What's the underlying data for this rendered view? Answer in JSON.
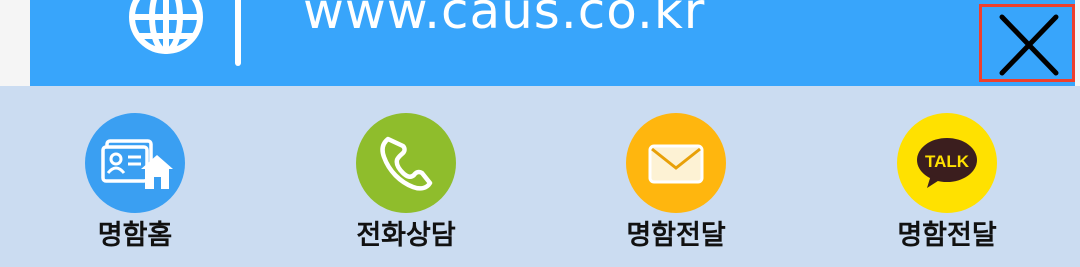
{
  "banner": {
    "url": "www.caus.co.kr",
    "icon": "globe-icon",
    "close_icon": "close-icon"
  },
  "share": {
    "items": [
      {
        "label": "명함홈",
        "icon": "card-home-icon",
        "color": "#3a9ff2"
      },
      {
        "label": "전화상담",
        "icon": "phone-icon",
        "color": "#8fbd2c"
      },
      {
        "label": "명함전달",
        "icon": "mail-icon",
        "color": "#ffb60e"
      },
      {
        "label": "명함전달",
        "icon": "kakaotalk-icon",
        "talk_text": "TALK",
        "color": "#ffe100"
      }
    ]
  },
  "colors": {
    "banner": "#38a5fb",
    "share_bar": "#cbdcf1",
    "close_border": "#ee3f2c"
  }
}
